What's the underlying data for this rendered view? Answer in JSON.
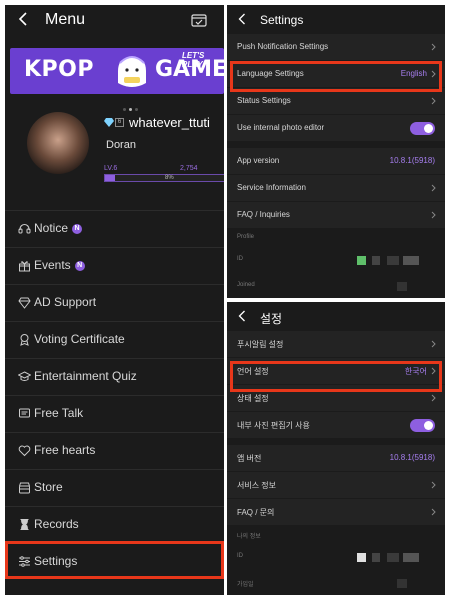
{
  "menu": {
    "title": "Menu",
    "banner": {
      "small": "LET'S PLAY",
      "left": "KPOP",
      "right": "GAME"
    },
    "profile": {
      "username": "whatever_ttuti",
      "level_badge": "6",
      "nickname": "Doran",
      "level": "LV.6",
      "points": "2,754",
      "progress_percent": 8,
      "progress_label": "8%"
    },
    "items": [
      {
        "label": "Notice",
        "icon": "headset-icon",
        "badge": "N"
      },
      {
        "label": "Events",
        "icon": "gift-icon",
        "badge": "N"
      },
      {
        "label": "AD Support",
        "icon": "diamond-icon"
      },
      {
        "label": "Voting Certificate",
        "icon": "award-icon"
      },
      {
        "label": "Entertainment Quiz",
        "icon": "graduation-cap-icon"
      },
      {
        "label": "Free Talk",
        "icon": "chat-icon"
      },
      {
        "label": "Free hearts",
        "icon": "heart-icon"
      },
      {
        "label": "Store",
        "icon": "store-icon"
      },
      {
        "label": "Records",
        "icon": "hourglass-icon"
      },
      {
        "label": "Settings",
        "icon": "sliders-icon"
      }
    ]
  },
  "settings_en": {
    "title": "Settings",
    "rows": [
      {
        "label": "Push Notification Settings"
      },
      {
        "label": "Language Settings",
        "value": "English"
      },
      {
        "label": "Status Settings"
      },
      {
        "label": "Use internal photo editor"
      },
      {
        "label": "App version",
        "value": "10.8.1(5918)"
      },
      {
        "label": "Service Information"
      },
      {
        "label": "FAQ / Inquiries"
      }
    ],
    "caption": "Profile",
    "id_label": "ID",
    "joined_label": "Joined"
  },
  "settings_ko": {
    "title": "설정",
    "rows": [
      {
        "label": "푸시알림 설정"
      },
      {
        "label": "언어 설정",
        "value": "한국어"
      },
      {
        "label": "상태 설정"
      },
      {
        "label": "내부 사진 편집기 사용"
      },
      {
        "label": "앱 버전",
        "value": "10.8.1(5918)"
      },
      {
        "label": "서비스 정보"
      },
      {
        "label": "FAQ / 문의"
      }
    ],
    "caption": "나의 정보",
    "id_label": "ID",
    "joined_label": "가입일"
  },
  "colors": {
    "accent": "#8e5fe0",
    "highlight": "#e8371a",
    "background": "#1b1b1b"
  }
}
